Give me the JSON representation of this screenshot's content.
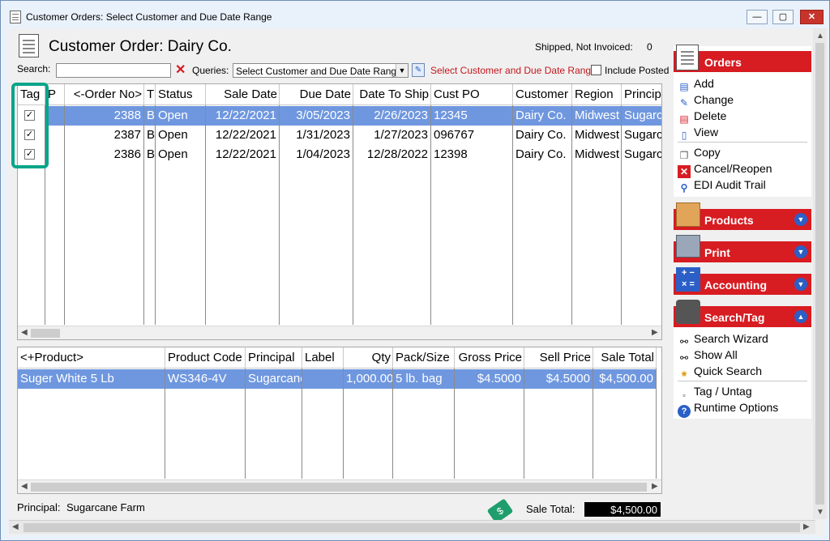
{
  "window": {
    "title": "Customer Orders: Select Customer and Due Date Range",
    "min": "—",
    "max": "▢",
    "close": "✕"
  },
  "header": {
    "title": "Customer Order: Dairy Co.",
    "status_label": "Shipped, Not Invoiced:",
    "status_value": "0"
  },
  "toolbar": {
    "search_label": "Search:",
    "search_value": "",
    "queries_label": "Queries:",
    "query_selected": "Select Customer and Due Date Range",
    "query_link": "Select Customer and Due Date Range",
    "include_posted_label": "Include Posted"
  },
  "orders": {
    "headers": [
      "Tag",
      "P",
      "<-Order No>",
      "T",
      "Status",
      "Sale Date",
      "Due Date",
      "Date To Ship",
      "Cust PO",
      "Customer",
      "Region",
      "Princip"
    ],
    "rows": [
      {
        "tag": "✓",
        "p": "",
        "order_no": "2388",
        "t": "B",
        "status": "Open",
        "sale_date": "12/22/2021",
        "due_date": "3/05/2023",
        "ship": "2/26/2023",
        "cust_po": "12345",
        "customer": "Dairy Co.",
        "region": "Midwest",
        "princip": "Sugarca"
      },
      {
        "tag": "✓",
        "p": "",
        "order_no": "2387",
        "t": "B",
        "status": "Open",
        "sale_date": "12/22/2021",
        "due_date": "1/31/2023",
        "ship": "1/27/2023",
        "cust_po": "096767",
        "customer": "Dairy Co.",
        "region": "Midwest",
        "princip": "Sugarca"
      },
      {
        "tag": "✓",
        "p": "",
        "order_no": "2386",
        "t": "B",
        "status": "Open",
        "sale_date": "12/22/2021",
        "due_date": "1/04/2023",
        "ship": "12/28/2022",
        "cust_po": "12398",
        "customer": "Dairy Co.",
        "region": "Midwest",
        "princip": "Sugarca"
      }
    ]
  },
  "products": {
    "headers": [
      "<+Product>",
      "Product Code",
      "Principal",
      "Label",
      "Qty",
      "Pack/Size",
      "Gross Price",
      "Sell Price",
      "Sale Total"
    ],
    "rows": [
      {
        "product": "Suger White 5 Lb",
        "code": "WS346-4V",
        "principal": "Sugarcane",
        "label": "",
        "qty": "1,000.00",
        "pack": "5 lb. bag",
        "gross": "$4.5000",
        "sell": "$4.5000",
        "total": "$4,500.00"
      }
    ]
  },
  "footer": {
    "principal_label": "Principal:",
    "principal_value": "Sugarcane Farm",
    "sale_total_label": "Sale Total:",
    "sale_total_value": "$4,500.00"
  },
  "sidebar": {
    "orders": {
      "title": "Orders",
      "items": [
        "Add",
        "Change",
        "Delete",
        "View",
        "Copy",
        "Cancel/Reopen",
        "EDI Audit Trail"
      ]
    },
    "products": {
      "title": "Products"
    },
    "print": {
      "title": "Print"
    },
    "accounting": {
      "title": "Accounting"
    },
    "search_tag": {
      "title": "Search/Tag",
      "items": [
        "Search Wizard",
        "Show All",
        "Quick Search",
        "Tag / Untag",
        "Runtime Options"
      ]
    }
  },
  "colors": {
    "accent": "#d71c22",
    "selection": "#6f97df",
    "highlight": "#0aa58a"
  }
}
